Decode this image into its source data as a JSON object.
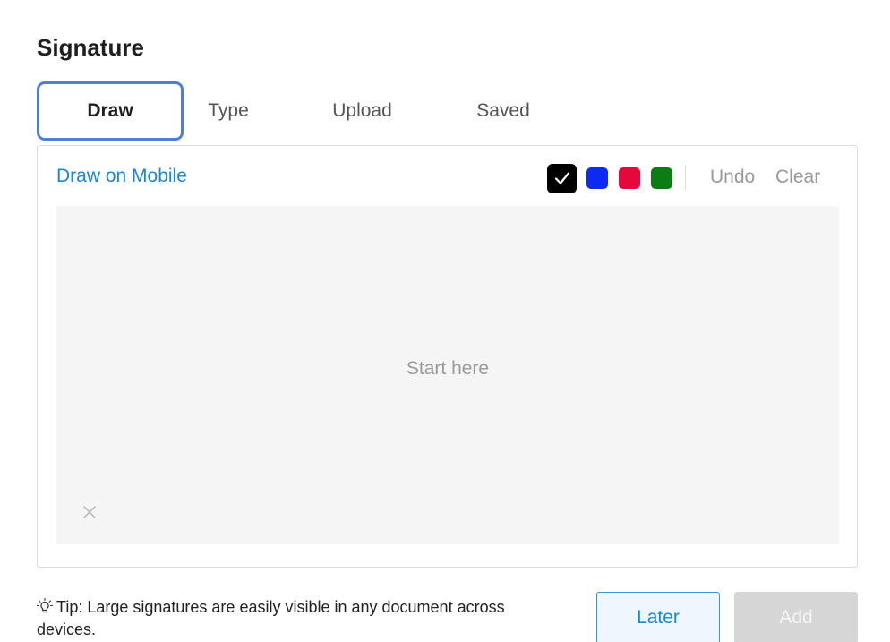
{
  "title": "Signature",
  "tabs": [
    {
      "label": "Draw",
      "active": true
    },
    {
      "label": "Type",
      "active": false
    },
    {
      "label": "Upload",
      "active": false
    },
    {
      "label": "Saved",
      "active": false
    }
  ],
  "panel": {
    "draw_on_mobile": "Draw on Mobile",
    "colors": [
      {
        "name": "black",
        "hex": "#000000",
        "selected": true
      },
      {
        "name": "blue",
        "hex": "#0b2bf2",
        "selected": false
      },
      {
        "name": "red",
        "hex": "#e6083c",
        "selected": false
      },
      {
        "name": "green",
        "hex": "#0c7d12",
        "selected": false
      }
    ],
    "undo": "Undo",
    "clear": "Clear",
    "canvas_hint": "Start here"
  },
  "tip": "Tip: Large signatures are easily visible in any document across devices.",
  "buttons": {
    "later": "Later",
    "add": "Add"
  },
  "accent": {
    "link": "#1a86d6",
    "focus": "#4a80d9"
  }
}
